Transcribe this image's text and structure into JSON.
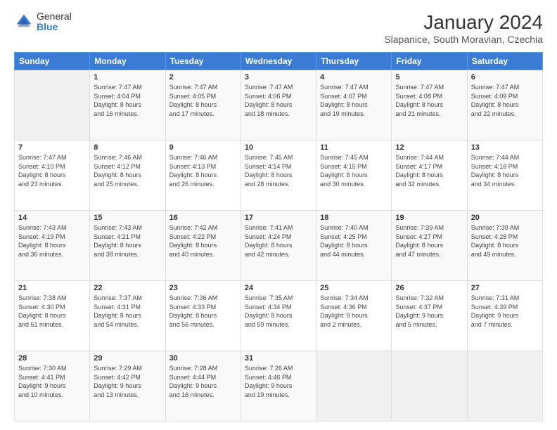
{
  "logo": {
    "general": "General",
    "blue": "Blue"
  },
  "title": "January 2024",
  "subtitle": "Slapanice, South Moravian, Czechia",
  "headers": [
    "Sunday",
    "Monday",
    "Tuesday",
    "Wednesday",
    "Thursday",
    "Friday",
    "Saturday"
  ],
  "weeks": [
    [
      {
        "day": "",
        "info": ""
      },
      {
        "day": "1",
        "info": "Sunrise: 7:47 AM\nSunset: 4:04 PM\nDaylight: 8 hours\nand 16 minutes."
      },
      {
        "day": "2",
        "info": "Sunrise: 7:47 AM\nSunset: 4:05 PM\nDaylight: 8 hours\nand 17 minutes."
      },
      {
        "day": "3",
        "info": "Sunrise: 7:47 AM\nSunset: 4:06 PM\nDaylight: 8 hours\nand 18 minutes."
      },
      {
        "day": "4",
        "info": "Sunrise: 7:47 AM\nSunset: 4:07 PM\nDaylight: 8 hours\nand 19 minutes."
      },
      {
        "day": "5",
        "info": "Sunrise: 7:47 AM\nSunset: 4:08 PM\nDaylight: 8 hours\nand 21 minutes."
      },
      {
        "day": "6",
        "info": "Sunrise: 7:47 AM\nSunset: 4:09 PM\nDaylight: 8 hours\nand 22 minutes."
      }
    ],
    [
      {
        "day": "7",
        "info": "Sunrise: 7:47 AM\nSunset: 4:10 PM\nDaylight: 8 hours\nand 23 minutes."
      },
      {
        "day": "8",
        "info": "Sunrise: 7:46 AM\nSunset: 4:12 PM\nDaylight: 8 hours\nand 25 minutes."
      },
      {
        "day": "9",
        "info": "Sunrise: 7:46 AM\nSunset: 4:13 PM\nDaylight: 8 hours\nand 26 minutes."
      },
      {
        "day": "10",
        "info": "Sunrise: 7:45 AM\nSunset: 4:14 PM\nDaylight: 8 hours\nand 28 minutes."
      },
      {
        "day": "11",
        "info": "Sunrise: 7:45 AM\nSunset: 4:15 PM\nDaylight: 8 hours\nand 30 minutes."
      },
      {
        "day": "12",
        "info": "Sunrise: 7:44 AM\nSunset: 4:17 PM\nDaylight: 8 hours\nand 32 minutes."
      },
      {
        "day": "13",
        "info": "Sunrise: 7:44 AM\nSunset: 4:18 PM\nDaylight: 8 hours\nand 34 minutes."
      }
    ],
    [
      {
        "day": "14",
        "info": "Sunrise: 7:43 AM\nSunset: 4:19 PM\nDaylight: 8 hours\nand 36 minutes."
      },
      {
        "day": "15",
        "info": "Sunrise: 7:43 AM\nSunset: 4:21 PM\nDaylight: 8 hours\nand 38 minutes."
      },
      {
        "day": "16",
        "info": "Sunrise: 7:42 AM\nSunset: 4:22 PM\nDaylight: 8 hours\nand 40 minutes."
      },
      {
        "day": "17",
        "info": "Sunrise: 7:41 AM\nSunset: 4:24 PM\nDaylight: 8 hours\nand 42 minutes."
      },
      {
        "day": "18",
        "info": "Sunrise: 7:40 AM\nSunset: 4:25 PM\nDaylight: 8 hours\nand 44 minutes."
      },
      {
        "day": "19",
        "info": "Sunrise: 7:39 AM\nSunset: 4:27 PM\nDaylight: 8 hours\nand 47 minutes."
      },
      {
        "day": "20",
        "info": "Sunrise: 7:39 AM\nSunset: 4:28 PM\nDaylight: 8 hours\nand 49 minutes."
      }
    ],
    [
      {
        "day": "21",
        "info": "Sunrise: 7:38 AM\nSunset: 4:30 PM\nDaylight: 8 hours\nand 51 minutes."
      },
      {
        "day": "22",
        "info": "Sunrise: 7:37 AM\nSunset: 4:31 PM\nDaylight: 8 hours\nand 54 minutes."
      },
      {
        "day": "23",
        "info": "Sunrise: 7:36 AM\nSunset: 4:33 PM\nDaylight: 8 hours\nand 56 minutes."
      },
      {
        "day": "24",
        "info": "Sunrise: 7:35 AM\nSunset: 4:34 PM\nDaylight: 8 hours\nand 59 minutes."
      },
      {
        "day": "25",
        "info": "Sunrise: 7:34 AM\nSunset: 4:36 PM\nDaylight: 9 hours\nand 2 minutes."
      },
      {
        "day": "26",
        "info": "Sunrise: 7:32 AM\nSunset: 4:37 PM\nDaylight: 9 hours\nand 5 minutes."
      },
      {
        "day": "27",
        "info": "Sunrise: 7:31 AM\nSunset: 4:39 PM\nDaylight: 9 hours\nand 7 minutes."
      }
    ],
    [
      {
        "day": "28",
        "info": "Sunrise: 7:30 AM\nSunset: 4:41 PM\nDaylight: 9 hours\nand 10 minutes."
      },
      {
        "day": "29",
        "info": "Sunrise: 7:29 AM\nSunset: 4:42 PM\nDaylight: 9 hours\nand 13 minutes."
      },
      {
        "day": "30",
        "info": "Sunrise: 7:28 AM\nSunset: 4:44 PM\nDaylight: 9 hours\nand 16 minutes."
      },
      {
        "day": "31",
        "info": "Sunrise: 7:26 AM\nSunset: 4:46 PM\nDaylight: 9 hours\nand 19 minutes."
      },
      {
        "day": "",
        "info": ""
      },
      {
        "day": "",
        "info": ""
      },
      {
        "day": "",
        "info": ""
      }
    ]
  ]
}
